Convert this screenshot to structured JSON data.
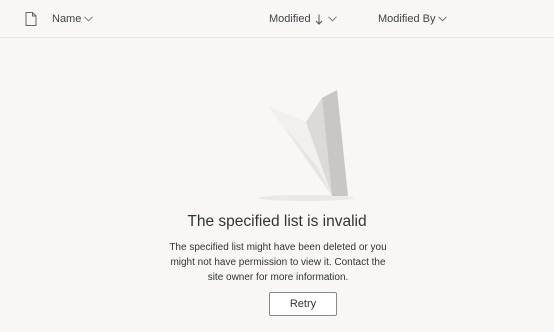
{
  "columns": {
    "file_type_icon": "document-icon",
    "name_label": "Name",
    "modified_label": "Modified",
    "modified_sort_indicator": "↓",
    "modified_by_label": "Modified By"
  },
  "empty_state": {
    "illustration": "paper-airplane-illustration",
    "title": "The specified list is invalid",
    "message": "The specified list might have been deleted or you might not have permission to view it. Contact the site owner for more information.",
    "retry_label": "Retry"
  },
  "colors": {
    "background": "#f8f7f6",
    "text": "#323130",
    "divider": "#e8e6e4",
    "button_border": "#8a8886"
  }
}
